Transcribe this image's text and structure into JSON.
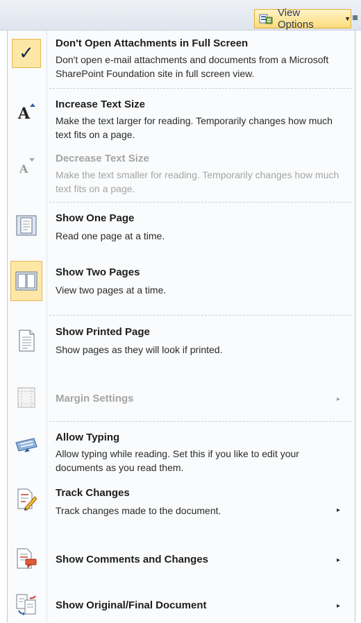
{
  "toolbar": {
    "view_options_label": "View Options"
  },
  "menu": {
    "items": [
      {
        "title": "Don't Open Attachments in Full Screen",
        "description": "Don't open e-mail attachments and documents from a Microsoft SharePoint Foundation site in full screen view.",
        "icon": "checkmark-icon",
        "checked": true,
        "disabled": false
      },
      {
        "title": "Increase Text Size",
        "description": "Make the text larger for reading. Temporarily changes how much text fits on a page.",
        "icon": "increase-text-icon",
        "disabled": false
      },
      {
        "title": "Decrease Text Size",
        "description": "Make the text smaller for reading. Temporarily changes how much text fits on a page.",
        "icon": "decrease-text-icon",
        "disabled": true
      },
      {
        "title": "Show One Page",
        "description": "Read one page at a time.",
        "icon": "one-page-icon",
        "disabled": false
      },
      {
        "title": "Show Two Pages",
        "description": "View two pages at a time.",
        "icon": "two-pages-icon",
        "checked": true,
        "disabled": false
      },
      {
        "title": "Show Printed Page",
        "description": "Show pages as they will look if printed.",
        "icon": "printed-page-icon",
        "disabled": false
      },
      {
        "title": "Margin Settings",
        "icon": "margin-settings-icon",
        "has_submenu": true,
        "disabled": true
      },
      {
        "title": "Allow Typing",
        "description": "Allow typing while reading. Set this if you like to edit your documents as you read them.",
        "icon": "allow-typing-icon",
        "disabled": false
      },
      {
        "title": "Track Changes",
        "description": "Track changes made to the document.",
        "icon": "track-changes-icon",
        "has_submenu": true,
        "disabled": false
      },
      {
        "title": "Show Comments and Changes",
        "icon": "comments-changes-icon",
        "has_submenu": true,
        "disabled": false
      },
      {
        "title": "Show Original/Final Document",
        "icon": "original-final-icon",
        "has_submenu": true,
        "disabled": false
      }
    ],
    "submenu_arrow": "▸"
  },
  "colors": {
    "highlight_fill": "#fde7a6",
    "highlight_border": "#e4b850",
    "disabled_text": "#a4a4a4"
  }
}
